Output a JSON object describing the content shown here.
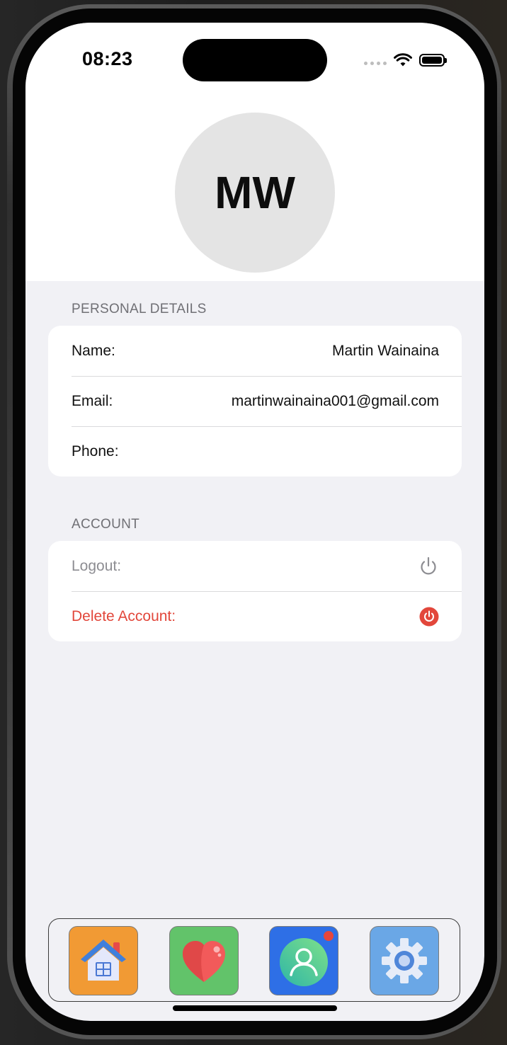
{
  "status_bar": {
    "time": "08:23"
  },
  "profile": {
    "initials": "MW"
  },
  "personal_details": {
    "title": "PERSONAL DETAILS",
    "rows": [
      {
        "label": "Name:",
        "value": "Martin Wainaina"
      },
      {
        "label": "Email:",
        "value": "martinwainaina001@gmail.com"
      },
      {
        "label": "Phone:",
        "value": ""
      }
    ]
  },
  "account": {
    "title": "ACCOUNT",
    "logout_label": "Logout:",
    "delete_label": "Delete Account:"
  },
  "tab_bar": {
    "tabs": [
      {
        "icon": "house-icon",
        "color": "#f19a34"
      },
      {
        "icon": "heart-icon",
        "color": "#62c36a"
      },
      {
        "icon": "person-icon",
        "color": "#2e6fe6",
        "badge": true
      },
      {
        "icon": "gear-icon",
        "color": "#6aa7e6"
      }
    ]
  },
  "colors": {
    "destructive": "#e2473b",
    "background": "#f1f1f5"
  }
}
